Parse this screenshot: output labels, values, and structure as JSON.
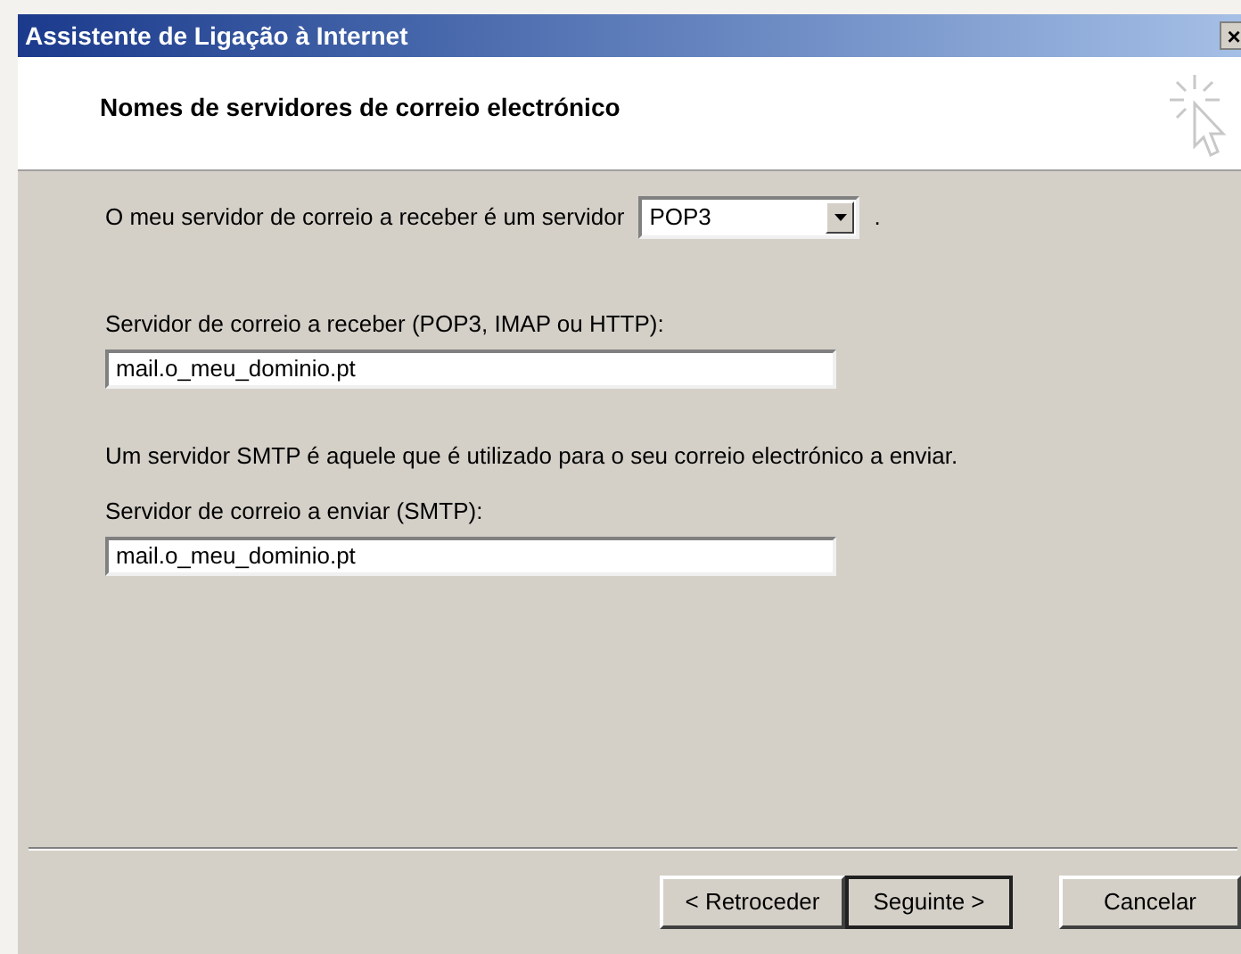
{
  "window": {
    "title": "Assistente de Ligação à Internet",
    "close": "×"
  },
  "header": {
    "title": "Nomes de servidores de correio electrónico"
  },
  "server_type": {
    "label": "O meu servidor de correio a receber é um servidor",
    "value": "POP3",
    "suffix": "."
  },
  "incoming": {
    "label": "Servidor de correio a receber (POP3, IMAP ou HTTP):",
    "value": "mail.o_meu_dominio.pt"
  },
  "smtp_note": "Um servidor SMTP é aquele que é utilizado para o seu correio electrónico a enviar.",
  "outgoing": {
    "label": "Servidor de correio a enviar (SMTP):",
    "value": "mail.o_meu_dominio.pt"
  },
  "buttons": [
    {
      "label": "< Retroceder",
      "focused": false
    },
    {
      "label": "Seguinte >",
      "focused": true
    },
    {
      "label": "Cancelar",
      "focused": false
    }
  ]
}
